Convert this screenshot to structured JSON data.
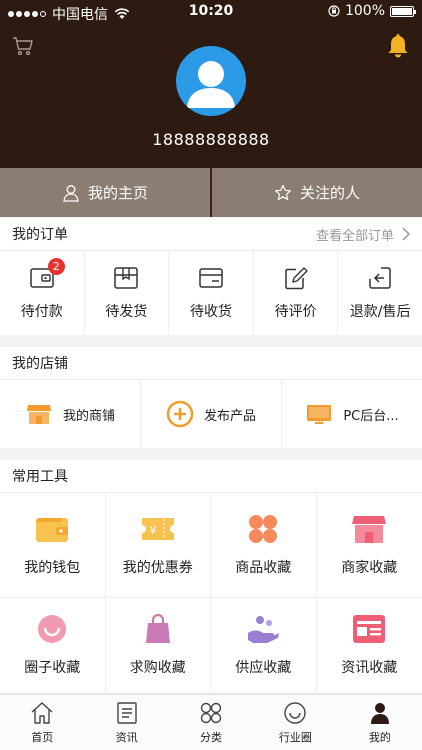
{
  "status": {
    "carrier": "中国电信",
    "time": "10:20",
    "battery": "100%"
  },
  "header": {
    "phone": "18888888888",
    "my_home": "我的主页",
    "following": "关注的人"
  },
  "orders": {
    "title": "我的订单",
    "view_all": "查看全部订单",
    "items": [
      {
        "label": "待付款",
        "icon": "wallet-icon",
        "badge": "2"
      },
      {
        "label": "待发货",
        "icon": "package-icon"
      },
      {
        "label": "待收货",
        "icon": "card-icon"
      },
      {
        "label": "待评价",
        "icon": "edit-icon"
      },
      {
        "label": "退款/售后",
        "icon": "return-icon"
      }
    ]
  },
  "store": {
    "title": "我的店铺",
    "items": [
      {
        "label": "我的商铺",
        "icon": "shop-icon"
      },
      {
        "label": "发布产品",
        "icon": "plus-circle-icon"
      },
      {
        "label": "PC后台...",
        "icon": "monitor-icon"
      }
    ]
  },
  "tools": {
    "title": "常用工具",
    "items": [
      {
        "label": "我的钱包",
        "icon": "wallet-icon"
      },
      {
        "label": "我的优惠券",
        "icon": "coupon-icon"
      },
      {
        "label": "商品收藏",
        "icon": "clover-icon"
      },
      {
        "label": "商家收藏",
        "icon": "store-icon"
      },
      {
        "label": "圈子收藏",
        "icon": "smile-icon"
      },
      {
        "label": "求购收藏",
        "icon": "bag-icon"
      },
      {
        "label": "供应收藏",
        "icon": "hand-icon"
      },
      {
        "label": "资讯收藏",
        "icon": "news-icon"
      }
    ]
  },
  "tabs": [
    {
      "label": "首页",
      "icon": "home-icon"
    },
    {
      "label": "资讯",
      "icon": "news-icon"
    },
    {
      "label": "分类",
      "icon": "category-icon"
    },
    {
      "label": "行业圈",
      "icon": "circle-icon"
    },
    {
      "label": "我的",
      "icon": "user-icon",
      "active": true
    }
  ],
  "colors": {
    "header_bg": "#2d1a10",
    "buttons_bg": "#8c7d72",
    "orange": "#f39c2d",
    "pink": "#ee6d7f",
    "badge": "#e7332f"
  }
}
